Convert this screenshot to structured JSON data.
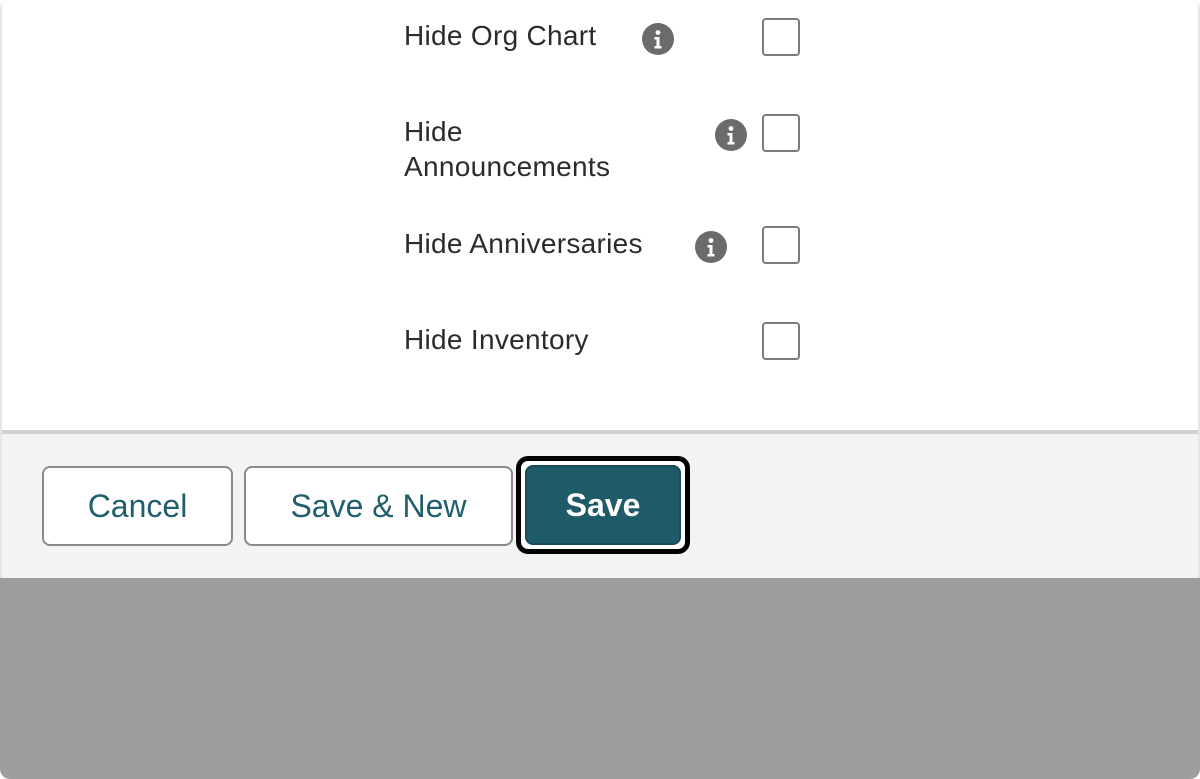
{
  "form": {
    "fields": [
      {
        "label": "Hide Org Chart",
        "has_info": true,
        "checked": false
      },
      {
        "label": "Hide Announcements",
        "has_info": true,
        "checked": false
      },
      {
        "label": "Hide Anniversaries",
        "has_info": true,
        "checked": false
      },
      {
        "label": "Hide Inventory",
        "has_info": false,
        "checked": false
      }
    ]
  },
  "footer": {
    "cancel_label": "Cancel",
    "save_new_label": "Save & New",
    "save_label": "Save"
  },
  "colors": {
    "accent": "#1e5a68",
    "button_text": "#1f5f6b",
    "overlay": "#9e9e9e",
    "footer_bg": "#f3f3f3",
    "info_icon": "#6b6b6b"
  },
  "icons": {
    "info": "info-icon",
    "checkbox": "checkbox-icon"
  }
}
